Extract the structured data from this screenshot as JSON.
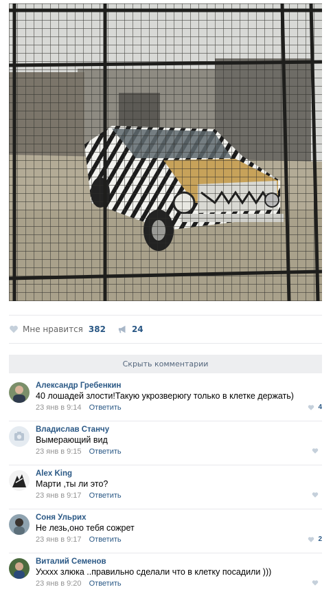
{
  "post": {
    "likes": {
      "label": "Мне нравится",
      "count": "382"
    },
    "shares": {
      "count": "24"
    }
  },
  "hide_comments_label": "Скрыть комментарии",
  "comments": [
    {
      "author": "Александр Гребенкин",
      "text": "40 лошадей злости!Такую укрозверюгу только в клетке держать)",
      "date": "23 янв в 9:14",
      "reply": "Ответить",
      "likes": "4"
    },
    {
      "author": "Владислав Станчу",
      "text": "Вымерающий вид",
      "date": "23 янв в 9:15",
      "reply": "Ответить",
      "likes": ""
    },
    {
      "author": "Alex King",
      "text": "Марти ,ты ли это?",
      "date": "23 янв в 9:17",
      "reply": "Ответить",
      "likes": ""
    },
    {
      "author": "Соня Ульрих",
      "text": "Не лезь,оно тебя сожрет",
      "date": "23 янв в 9:17",
      "reply": "Ответить",
      "likes": "2"
    },
    {
      "author": "Виталий Семенов",
      "text": "Ухххх злюка ..правильно сделали что в клетку посадили )))",
      "date": "23 янв в 9:20",
      "reply": "Ответить",
      "likes": ""
    }
  ]
}
